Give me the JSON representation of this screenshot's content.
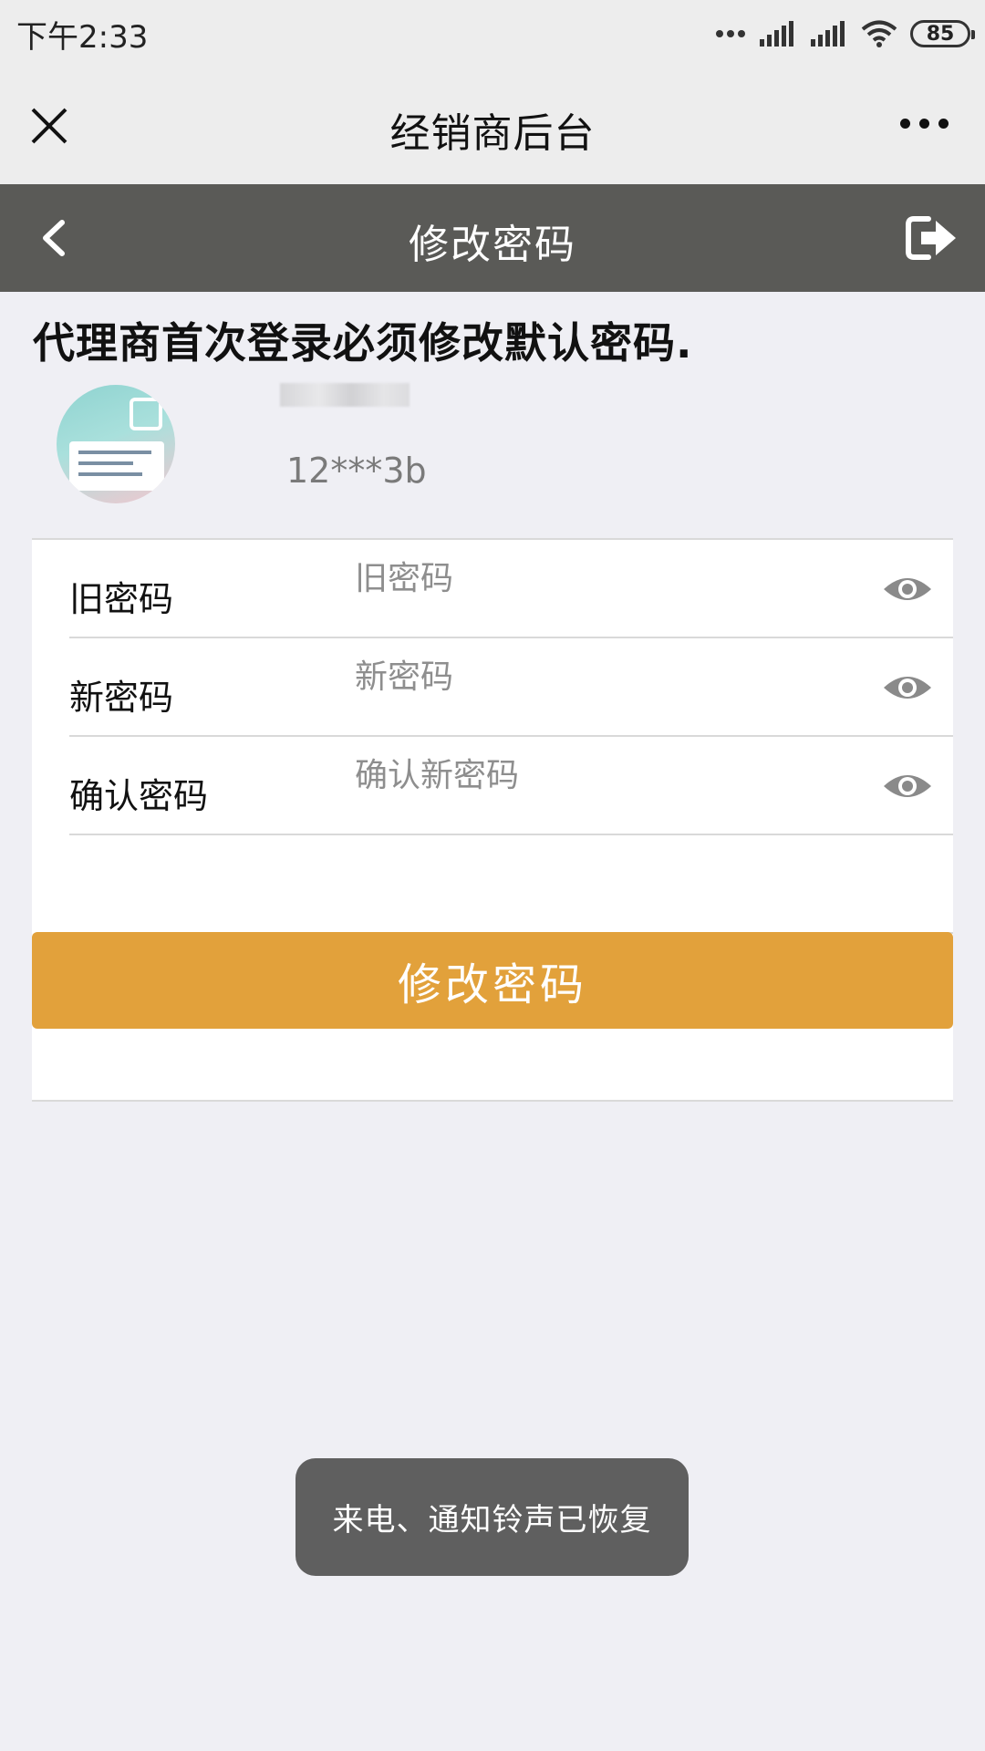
{
  "status_bar": {
    "time": "下午2:33",
    "battery": "85"
  },
  "wechat_bar": {
    "title": "经销商后台"
  },
  "page_header": {
    "title": "修改密码"
  },
  "notice": "代理商首次登录必须修改默认密码.",
  "user": {
    "id": "12***3b"
  },
  "form": {
    "fields": [
      {
        "label": "旧密码",
        "placeholder": "旧密码"
      },
      {
        "label": "新密码",
        "placeholder": "新密码"
      },
      {
        "label": "确认密码",
        "placeholder": "确认新密码"
      }
    ],
    "submit_label": "修改密码"
  },
  "toast": "来电、通知铃声已恢复",
  "colors": {
    "header_bg": "#5a5a57",
    "button": "#e2a13b",
    "page_bg": "#efeff4"
  }
}
